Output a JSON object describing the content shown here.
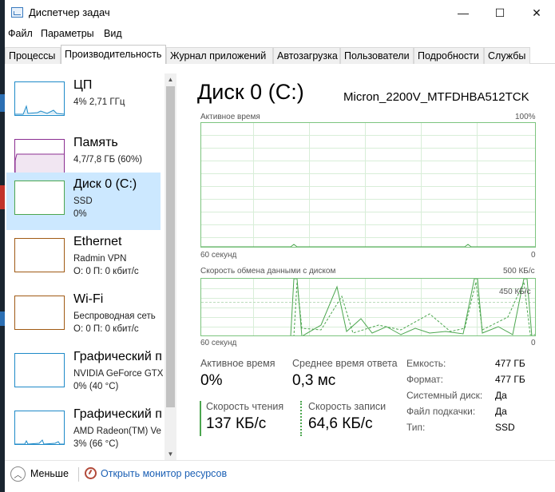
{
  "window": {
    "title": "Диспетчер задач",
    "minimize_glyph": "—",
    "maximize_glyph": "☐",
    "close_glyph": "✕"
  },
  "menu": [
    "Файл",
    "Параметры",
    "Вид"
  ],
  "tabs": [
    "Процессы",
    "Производительность",
    "Журнал приложений",
    "Автозагрузка",
    "Пользователи",
    "Подробности",
    "Службы"
  ],
  "active_tab": "Производительность",
  "sidebar": {
    "items": [
      {
        "title": "ЦП",
        "sub1": "4% 2,71 ГГц",
        "sub2": "",
        "color": "#1e8ac8"
      },
      {
        "title": "Память",
        "sub1": "4,7/7,8 ГБ (60%)",
        "sub2": "",
        "color": "#8b2e91"
      },
      {
        "title": "Диск 0 (C:)",
        "sub1": "SSD",
        "sub2": "0%",
        "color": "#4ca64f"
      },
      {
        "title": "Ethernet",
        "sub1": "Radmin VPN",
        "sub2": "О: 0 П: 0 кбит/с",
        "color": "#a05a14"
      },
      {
        "title": "Wi-Fi",
        "sub1": "Беспроводная сеть",
        "sub2": "О: 0 П: 0 кбит/с",
        "color": "#a05a14"
      },
      {
        "title": "Графический п",
        "sub1": "NVIDIA GeForce GTX",
        "sub2": "0% (40 °C)",
        "color": "#1e8ac8"
      },
      {
        "title": "Графический п",
        "sub1": "AMD Radeon(TM) Ve",
        "sub2": "3% (66 °C)",
        "color": "#1e8ac8"
      }
    ],
    "selected_index": 2,
    "cpu_usage": 0.04,
    "memory_usage": 0.6
  },
  "main": {
    "title": "Диск 0 (C:)",
    "model": "Micron_2200V_MTFDHBA512TCK",
    "graph1": {
      "label": "Активное время",
      "max": "100%",
      "time": "60 секунд",
      "min": "0"
    },
    "graph2": {
      "label": "Скорость обмена данными с диском",
      "max": "500 КБ/с",
      "mid": "450 КБ/с",
      "time": "60 секунд",
      "min": "0"
    },
    "stats": {
      "active_label": "Активное время",
      "active_value": "0%",
      "response_label": "Среднее время ответа",
      "response_value": "0,3 мс",
      "read_label": "Скорость чтения",
      "read_value": "137 КБ/с",
      "write_label": "Скорость записи",
      "write_value": "64,6 КБ/с"
    },
    "props": [
      {
        "label": "Емкость:",
        "value": "477 ГБ"
      },
      {
        "label": "Формат:",
        "value": "477 ГБ"
      },
      {
        "label": "Системный диск:",
        "value": "Да"
      },
      {
        "label": "Файл подкачки:",
        "value": "Да"
      },
      {
        "label": "Тип:",
        "value": "SSD"
      }
    ],
    "graph_color": "#4ca64f"
  },
  "footer": {
    "less": "Меньше",
    "monitor": "Открыть монитор ресурсов"
  }
}
